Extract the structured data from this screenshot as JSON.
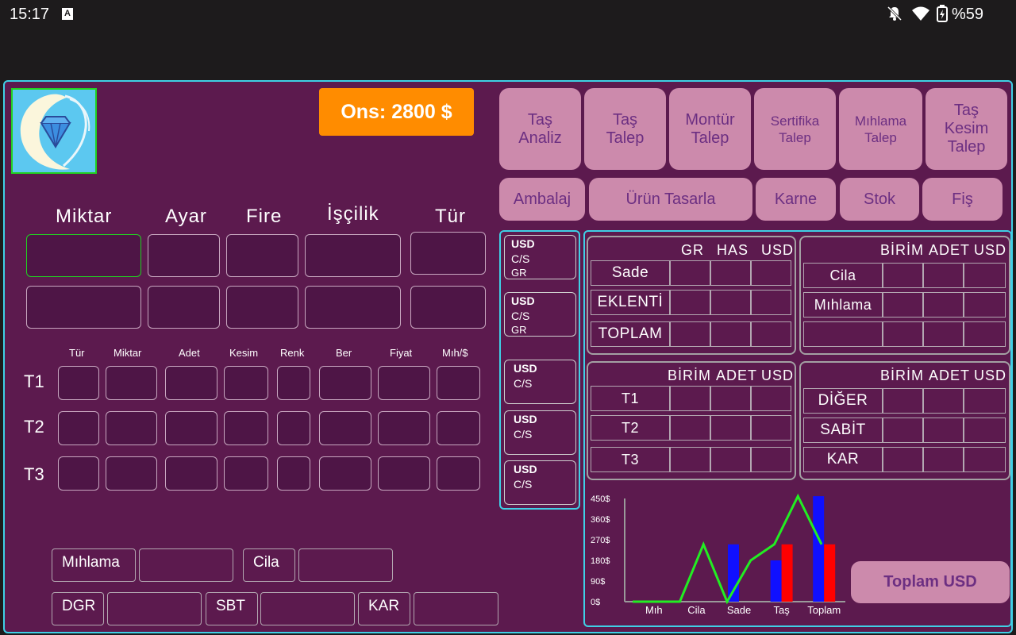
{
  "status": {
    "time": "15:17",
    "battery": "%59",
    "icons": [
      "a-font-icon",
      "bell-off-icon",
      "wifi-icon",
      "battery-charging-icon"
    ]
  },
  "price": {
    "label": "Ons: 2800 $"
  },
  "colors": {
    "bg": "#5c1a4e",
    "accent": "#3fd0e6",
    "button": "#cc8aac",
    "buttonText": "#6c2f82",
    "orange": "#ff8c00"
  },
  "top_buttons": [
    {
      "label": "Taş\nAnaliz"
    },
    {
      "label": "Taş\nTalep"
    },
    {
      "label": "Montür\nTalep"
    },
    {
      "label": "Sertifika\nTalep"
    },
    {
      "label": "Mıhlama\nTalep"
    },
    {
      "label": "Taş\nKesim\nTalep"
    }
  ],
  "second_buttons": [
    {
      "label": "Ambalaj"
    },
    {
      "label": "Ürün Tasarla"
    },
    {
      "label": "Karne"
    },
    {
      "label": "Stok"
    },
    {
      "label": "Fiş"
    }
  ],
  "main_headers": [
    "Miktar",
    "Ayar",
    "Fire",
    "İşçilik",
    "Tür"
  ],
  "stone_headers": [
    "Tür",
    "Miktar",
    "Adet",
    "Kesim",
    "Renk",
    "Ber",
    "Fiyat",
    "Mıh/$"
  ],
  "stone_rows": [
    "T1",
    "T2",
    "T3"
  ],
  "usd_boxes": [
    {
      "line1": "USD",
      "line2": "C/S",
      "line3": "GR"
    },
    {
      "line1": "USD",
      "line2": "C/S",
      "line3": "GR"
    },
    {
      "line1": "USD",
      "line2": "C/S"
    },
    {
      "line1": "USD",
      "line2": "C/S"
    },
    {
      "line1": "USD",
      "line2": "C/S"
    }
  ],
  "panel1": {
    "headers": [
      "GR",
      "HAS",
      "USD"
    ],
    "rows": [
      "Sade",
      "EKLENTİ",
      "TOPLAM"
    ]
  },
  "panel2": {
    "headers": [
      "BİRİM",
      "ADET",
      "USD"
    ],
    "rows": [
      "Cila",
      "Mıhlama",
      ""
    ]
  },
  "panel3": {
    "headers": [
      "BİRİM",
      "ADET",
      "USD"
    ],
    "rows": [
      "T1",
      "T2",
      "T3"
    ]
  },
  "panel4": {
    "headers": [
      "BİRİM",
      "ADET",
      "USD"
    ],
    "rows": [
      "DİĞER",
      "SABİT",
      "KAR"
    ]
  },
  "bottom": {
    "mihlama": "Mıhlama",
    "cila": "Cila",
    "dgr": "DGR",
    "sbt": "SBT",
    "kar": "KAR"
  },
  "toplam_button": "Toplam USD",
  "chart_data": {
    "type": "bar",
    "categories": [
      "Mıh",
      "Cila",
      "Sade",
      "Taş",
      "Toplam"
    ],
    "y_ticks": [
      "450$",
      "360$",
      "270$",
      "180$",
      "90$",
      "0$"
    ],
    "ylim": [
      0,
      450
    ],
    "series": [
      {
        "color": "#1010ff",
        "values": [
          0,
          0,
          250,
          180,
          460
        ]
      },
      {
        "color": "#ff0000",
        "values": [
          0,
          0,
          0,
          250,
          250
        ]
      }
    ],
    "line": {
      "color": "#22ee22",
      "values": [
        0,
        0,
        0,
        250,
        0,
        180,
        250,
        460,
        250
      ]
    }
  }
}
